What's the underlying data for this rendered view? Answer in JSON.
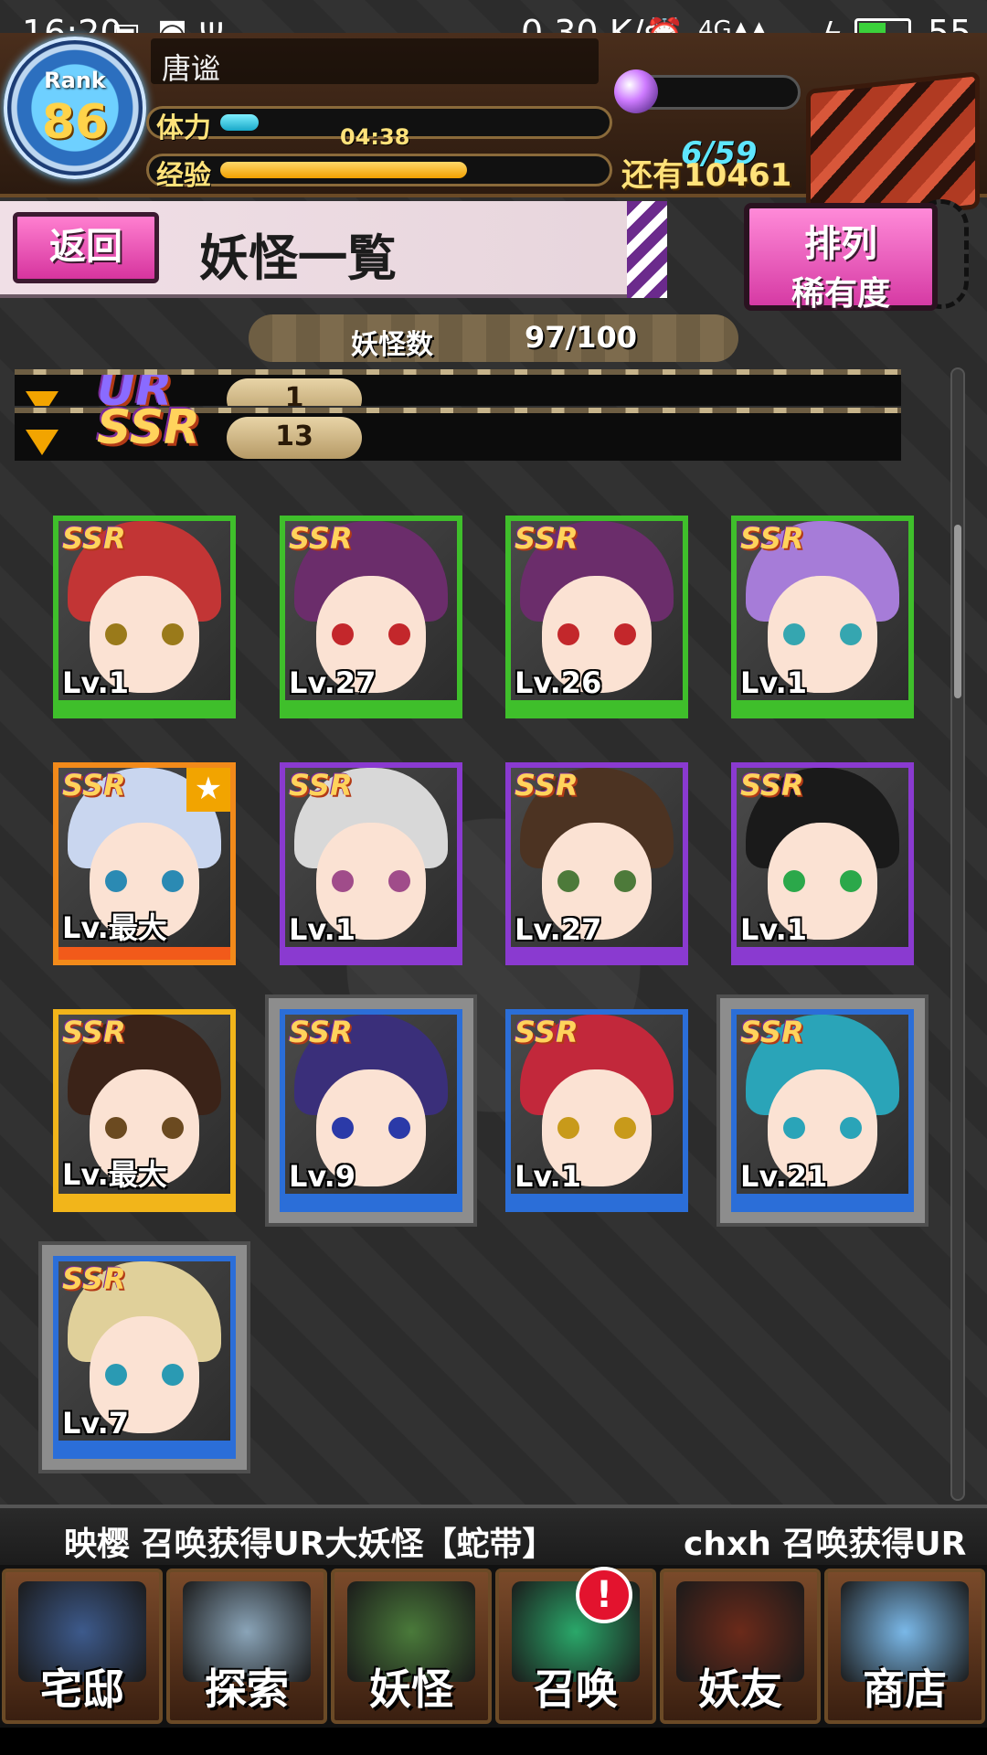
{
  "status_bar": {
    "time": "16:20",
    "icons": [
      "image-icon",
      "notification-icon",
      "usb-icon"
    ],
    "speed": "0.30 K/s",
    "battery": "55"
  },
  "player": {
    "rank_label": "Rank",
    "rank_value": "86",
    "name": "唐谧",
    "stamina_label": "体力",
    "stamina_timer": "04:38",
    "stamina_count": "6/59",
    "stamina_fill": 0.1,
    "exp_label": "经验",
    "exp_fill": 0.65,
    "exp_remaining": "还有10461"
  },
  "title_bar": {
    "back_label": "返回",
    "page_title": "妖怪一覧",
    "sort_label_1": "排列",
    "sort_label_2": "稀有度"
  },
  "monster_count": {
    "label": "妖怪数",
    "value": "97/100"
  },
  "rarity_groups": [
    {
      "badge": "UR",
      "count": "1"
    },
    {
      "badge": "SSR",
      "count": "13"
    }
  ],
  "cards": [
    {
      "rarity": "SSR",
      "level": "Lv.1",
      "frame": "#3fbf2b",
      "strip": "#3fbf2b",
      "hair": "#c23535",
      "eye": "#9a7a1a",
      "selected": false
    },
    {
      "rarity": "SSR",
      "level": "Lv.27",
      "frame": "#3fbf2b",
      "strip": "#3fbf2b",
      "hair": "#6b2d6b",
      "eye": "#c3272b",
      "selected": false
    },
    {
      "rarity": "SSR",
      "level": "Lv.26",
      "frame": "#3fbf2b",
      "strip": "#3fbf2b",
      "hair": "#6b2d6b",
      "eye": "#c3272b",
      "selected": false
    },
    {
      "rarity": "SSR",
      "level": "Lv.1",
      "frame": "#3fbf2b",
      "strip": "#3fbf2b",
      "hair": "#a67cd8",
      "eye": "#35a6b0",
      "selected": false
    },
    {
      "rarity": "SSR",
      "level": "Lv.最大",
      "frame": "#f28a1a",
      "strip": "#f25a1a",
      "hair": "#c9d6ef",
      "eye": "#2b8ab3",
      "selected": false,
      "star": "★"
    },
    {
      "rarity": "SSR",
      "level": "Lv.1",
      "frame": "#8a3ad0",
      "strip": "#8a3ad0",
      "hair": "#d8d8d8",
      "eye": "#a04c8a",
      "selected": false
    },
    {
      "rarity": "SSR",
      "level": "Lv.27",
      "frame": "#8a3ad0",
      "strip": "#8a3ad0",
      "hair": "#4c3322",
      "eye": "#4d7a3a",
      "selected": false
    },
    {
      "rarity": "SSR",
      "level": "Lv.1",
      "frame": "#8a3ad0",
      "strip": "#8a3ad0",
      "hair": "#1a1a1a",
      "eye": "#2ba84a",
      "selected": false
    },
    {
      "rarity": "SSR",
      "level": "Lv.最大",
      "frame": "#f2b51a",
      "strip": "#f2b51a",
      "hair": "#3b2318",
      "eye": "#6b4a20",
      "selected": false
    },
    {
      "rarity": "SSR",
      "level": "Lv.9",
      "frame": "#2b6ed8",
      "strip": "#2b6ed8",
      "hair": "#3a2f7a",
      "eye": "#2b3aa8",
      "selected": true
    },
    {
      "rarity": "SSR",
      "level": "Lv.1",
      "frame": "#2b6ed8",
      "strip": "#2b6ed8",
      "hair": "#c2283b",
      "eye": "#c89a1a",
      "selected": false
    },
    {
      "rarity": "SSR",
      "level": "Lv.21",
      "frame": "#2b6ed8",
      "strip": "#2b6ed8",
      "hair": "#2aa4b8",
      "eye": "#2aa4b8",
      "selected": true
    },
    {
      "rarity": "SSR",
      "level": "Lv.7",
      "frame": "#2b6ed8",
      "strip": "#2b6ed8",
      "hair": "#e0d09a",
      "eye": "#2a9ab3",
      "selected": true
    }
  ],
  "ticker": {
    "message_1": "映樱 召唤获得UR大妖怪【蛇带】",
    "message_2": "chxh 召唤获得UR"
  },
  "bottom_nav": [
    {
      "label": "宅邸",
      "icon": "house-icon",
      "color": "#3d5a8c"
    },
    {
      "label": "探索",
      "icon": "magnifier-icon",
      "color": "#8aa4b8"
    },
    {
      "label": "妖怪",
      "icon": "scroll-icon",
      "color": "#4a7a3a"
    },
    {
      "label": "召唤",
      "icon": "pentagram-icon",
      "color": "#2aa86a",
      "alert": "!"
    },
    {
      "label": "妖友",
      "icon": "catgirl-icon",
      "color": "#6b2a1a"
    },
    {
      "label": "商店",
      "icon": "orb-icon",
      "color": "#7ab8e8"
    }
  ]
}
